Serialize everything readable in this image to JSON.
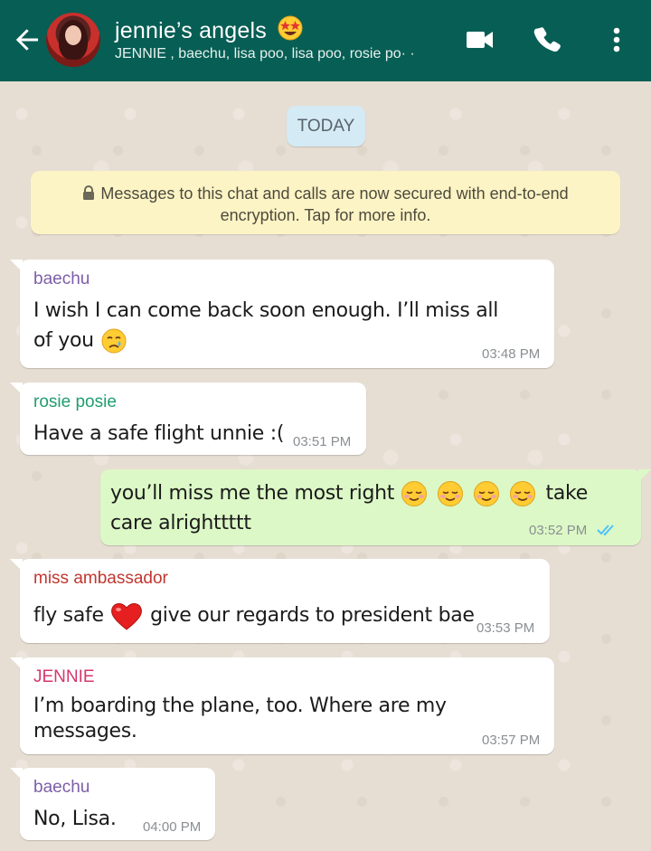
{
  "header": {
    "title": "jennie’s angels",
    "subtitle": "JENNIE , baechu, lisa poo, lisa poo, rosie po· ·",
    "icons": [
      "back-arrow-icon",
      "video-call-icon",
      "voice-call-icon",
      "more-options-icon"
    ]
  },
  "date_chip": "TODAY",
  "notice": {
    "text": "Messages to this chat and calls are now secured with end-to-end encryption. Tap for more info."
  },
  "messages": [
    {
      "sender": "baechu",
      "sender_color": "#7d5ea8",
      "text": "I wish I can come back soon enough. I’ll miss all of you",
      "time": "03:48 PM",
      "emoji": "crying-face"
    },
    {
      "sender": "rosie posie",
      "sender_color": "#1f9e6f",
      "text": "Have a safe flight unnie :(",
      "time": "03:51 PM"
    },
    {
      "outgoing": true,
      "text_before": "you’ll miss me the most right",
      "text_after": "take care alrighttttt",
      "time": "03:52 PM",
      "emoji": "smiling-face-x4",
      "status": "read"
    },
    {
      "sender": "miss ambassador",
      "sender_color": "#c1372f",
      "text_before": "fly safe",
      "text_after": "give our regards to president bae",
      "time": "03:53 PM",
      "emoji": "red-heart"
    },
    {
      "sender": "JENNIE",
      "sender_color": "#d6376b",
      "text": "I’m boarding the plane, too. Where are my messages.",
      "time": "03:57 PM"
    },
    {
      "sender": "baechu",
      "sender_color": "#7d5ea8",
      "text": "No, Lisa.",
      "time": "04:00 PM"
    }
  ],
  "colors": {
    "header": "#075e54",
    "outgoing_bubble": "#dcf8c6",
    "read_ticks": "#4fc3f7"
  }
}
